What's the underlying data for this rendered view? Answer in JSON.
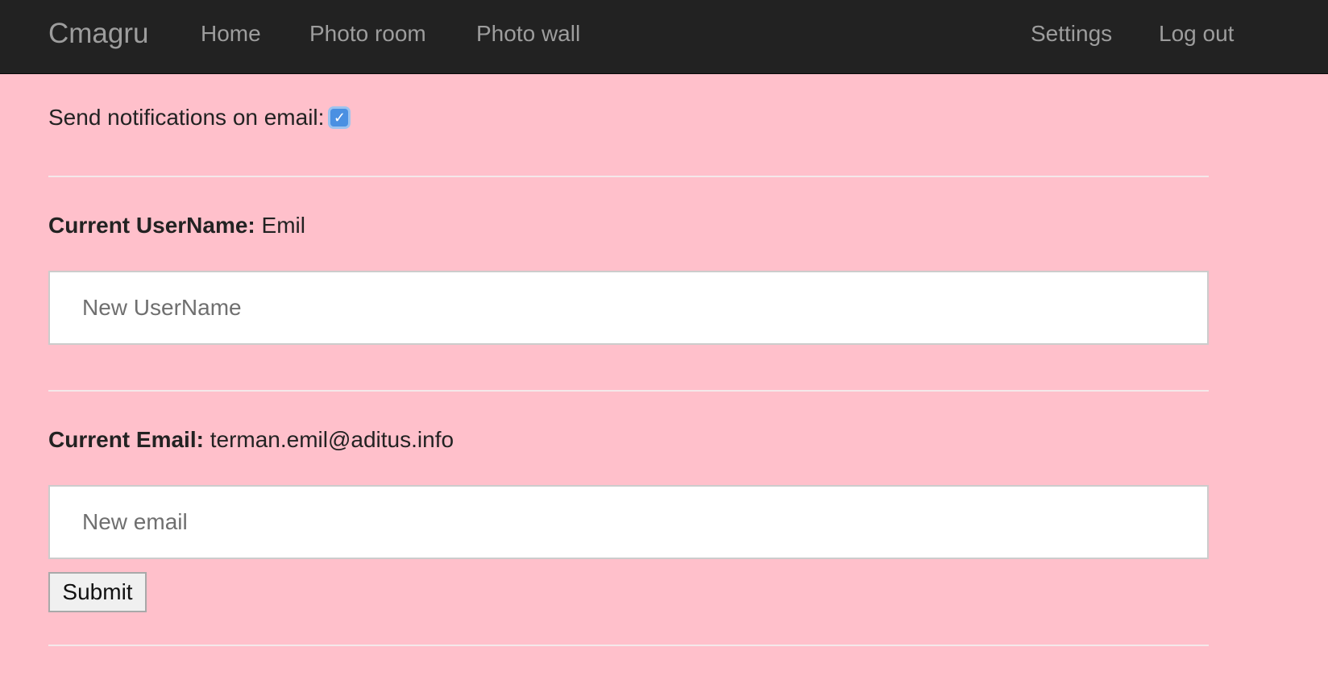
{
  "navbar": {
    "brand": "Cmagru",
    "left_links": [
      "Home",
      "Photo room",
      "Photo wall"
    ],
    "right_links": [
      "Settings",
      "Log out"
    ]
  },
  "notifications": {
    "label": "Send notifications on email:",
    "checked": true
  },
  "username": {
    "label": "Current UserName:",
    "value": "Emil",
    "placeholder": "New UserName"
  },
  "email": {
    "label": "Current Email:",
    "value": "terman.emil@aditus.info",
    "placeholder": "New email"
  },
  "submit": {
    "label": "Submit"
  },
  "colors": {
    "page_background": "#ffc0cb",
    "navbar_background": "#222222",
    "nav_link": "#9d9d9d",
    "checkbox_accent": "#4a90e2"
  }
}
